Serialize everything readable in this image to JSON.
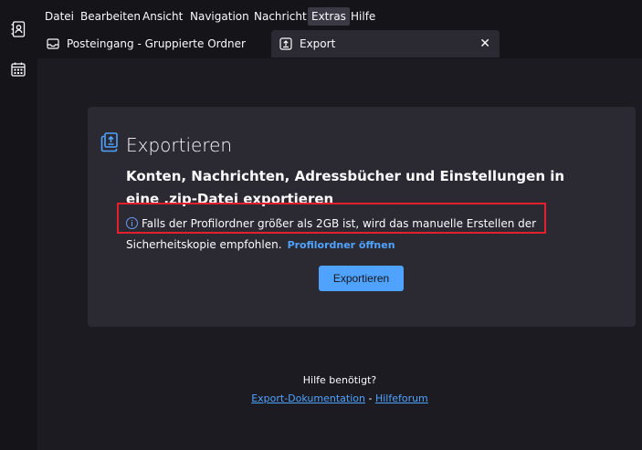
{
  "spaces": {
    "address_book_icon": "address-book-icon",
    "calendar_icon": "calendar-icon"
  },
  "menubar": {
    "items": [
      "Datei",
      "Bearbeiten",
      "Ansicht",
      "Navigation",
      "Nachricht",
      "Extras",
      "Hilfe"
    ],
    "active": "Extras"
  },
  "tabs": [
    {
      "label": "Posteingang - Gruppierte Ordner",
      "icon": "inbox-icon"
    },
    {
      "label": "Export",
      "icon": "export-icon",
      "close": "✕"
    }
  ],
  "export": {
    "title": "Exportieren",
    "description": "Konten, Nachrichten, Adressbücher und Einstellungen in eine .zip-Datei exportieren",
    "notice": "Falls der Profilordner größer als 2GB ist, wird das manuelle Erstellen der Sicherheitskopie empfohlen.",
    "profile_link": "Profilordner öffnen",
    "button": "Exportieren"
  },
  "help": {
    "question": "Hilfe benötigt?",
    "doc_link": "Export-Dokumentation",
    "separator": " - ",
    "forum_link": "Hilfeforum"
  },
  "colors": {
    "accent": "#4fa3ff",
    "highlight_box": "#e5202e"
  }
}
